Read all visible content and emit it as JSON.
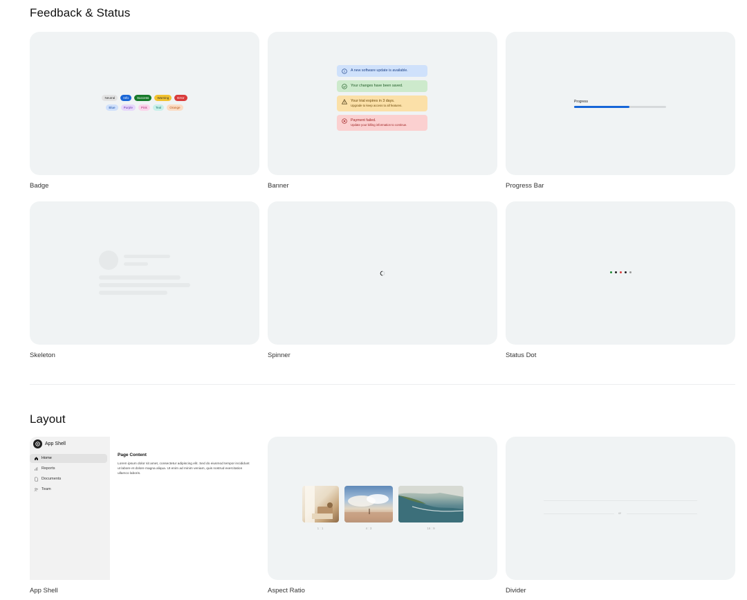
{
  "sections": {
    "feedback_title": "Feedback & Status",
    "layout_title": "Layout"
  },
  "cards": {
    "badge": "Badge",
    "banner": "Banner",
    "progress_bar": "Progress Bar",
    "skeleton": "Skeleton",
    "spinner": "Spinner",
    "status_dot": "Status Dot",
    "app_shell": "App Shell",
    "aspect_ratio": "Aspect Ratio",
    "divider": "Divider"
  },
  "badges": {
    "row1": [
      {
        "label": "Neutral",
        "bg": "#e3e3e3",
        "fg": "#333333"
      },
      {
        "label": "Info",
        "bg": "#1a66d6",
        "fg": "#ffffff"
      },
      {
        "label": "Success",
        "bg": "#177a2a",
        "fg": "#ffffff"
      },
      {
        "label": "Warning",
        "bg": "#f2c230",
        "fg": "#333333"
      },
      {
        "label": "Error",
        "bg": "#d93b3b",
        "fg": "#ffffff"
      }
    ],
    "row2": [
      {
        "label": "Blue",
        "bg": "#cfe0fb",
        "fg": "#1a4fa8"
      },
      {
        "label": "Purple",
        "bg": "#e7d7fb",
        "fg": "#6b36b0"
      },
      {
        "label": "Pink",
        "bg": "#fbd4ea",
        "fg": "#b02c79"
      },
      {
        "label": "Teal",
        "bg": "#c9f0ea",
        "fg": "#1b7c6d"
      },
      {
        "label": "Orange",
        "bg": "#fbdcc4",
        "fg": "#b5561b"
      }
    ]
  },
  "banners": [
    {
      "kind": "info",
      "title": "A new software update is available.",
      "sub": "",
      "bg": "#cfe1fb",
      "fg": "#1a3f86"
    },
    {
      "kind": "success",
      "title": "Your changes have been saved.",
      "sub": "",
      "bg": "#cdeacc",
      "fg": "#1d5b24"
    },
    {
      "kind": "warning",
      "title": "Your trial expires in 3 days.",
      "sub": "Upgrade to keep access to all features.",
      "bg": "#fbe0a8",
      "fg": "#6a4708"
    },
    {
      "kind": "error",
      "title": "Payment failed.",
      "sub": "Update your billing information to continue.",
      "bg": "#fbd0d0",
      "fg": "#9b1b1b"
    }
  ],
  "progress": {
    "label": "Progress",
    "value": 0.6,
    "color": "#1565d8"
  },
  "status_dots": [
    "#1f8a34",
    "#222222",
    "#d93b3b",
    "#222222",
    "#9a9a9a"
  ],
  "app_shell": {
    "title": "App Shell",
    "nav": [
      {
        "label": "Home",
        "icon": "home-icon",
        "active": true
      },
      {
        "label": "Reports",
        "icon": "bar-chart-icon",
        "active": false
      },
      {
        "label": "Documents",
        "icon": "document-icon",
        "active": false
      },
      {
        "label": "Team",
        "icon": "team-icon",
        "active": false
      }
    ],
    "content_title": "Page Content",
    "content_text": "Lorem ipsum dolor sit amet, consectetur adipiscing elit. Sed do eiusmod tempor incididunt ut labore et dolore magna aliqua. Ut enim ad minim veniam, quis nostrud exercitation ullamco laboris."
  },
  "aspect_ratio": {
    "captions": [
      "1 : 1",
      "4 : 3",
      "16 : 9"
    ]
  },
  "divider": {
    "label": "or"
  }
}
